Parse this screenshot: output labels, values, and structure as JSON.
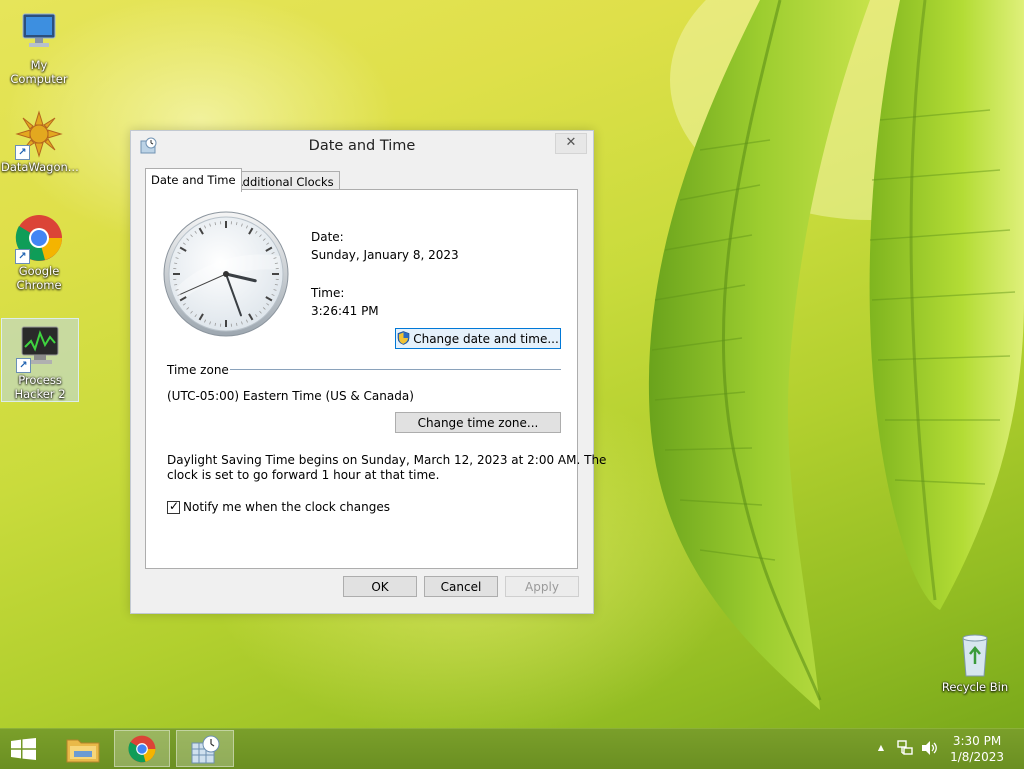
{
  "desktop": {
    "icons": [
      {
        "label": "My Computer"
      },
      {
        "label": "DataWagon..."
      },
      {
        "label": "Google Chrome"
      },
      {
        "label": "Process Hacker 2"
      },
      {
        "label": "Recycle Bin"
      }
    ]
  },
  "dialog": {
    "title": "Date and Time",
    "close_glyph": "✕",
    "tabs": [
      {
        "label": "Date and Time",
        "active": true
      },
      {
        "label": "Additional Clocks",
        "active": false
      }
    ],
    "date_label": "Date:",
    "date_value": "Sunday, January 8, 2023",
    "time_label": "Time:",
    "time_value": "3:26:41 PM",
    "change_date_button": "Change date and time...",
    "timezone_heading": "Time zone",
    "timezone_value": "(UTC-05:00) Eastern Time (US & Canada)",
    "change_timezone_button": "Change time zone...",
    "dst_line1": "Daylight Saving Time begins on Sunday, March 12, 2023 at 2:00 AM. The",
    "dst_line2": "clock is set to go forward 1 hour at that time.",
    "notify_label": "Notify me when the clock changes",
    "notify_checked": true,
    "ok_button": "OK",
    "cancel_button": "Cancel",
    "apply_button": "Apply",
    "analog_clock": {
      "hour": 3,
      "minute": 26,
      "second": 41
    }
  },
  "taskbar": {
    "items": [
      "start",
      "file-explorer",
      "google-chrome",
      "date-and-time"
    ],
    "tray_up_arrow": "▲",
    "clock_time": "3:30 PM",
    "clock_date": "1/8/2023"
  },
  "colors": {
    "accent": "#0078d7",
    "taskbar": "#6b8f22",
    "dialog_bg": "#f0f0f0"
  }
}
